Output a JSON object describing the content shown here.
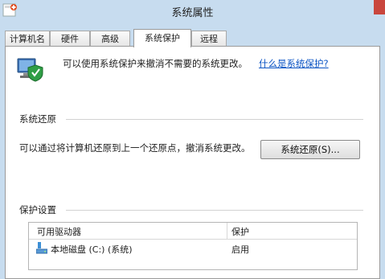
{
  "window": {
    "title": "系统属性"
  },
  "tabs": [
    {
      "label": "计算机名"
    },
    {
      "label": "硬件"
    },
    {
      "label": "高级"
    },
    {
      "label": "系统保护",
      "active": true
    },
    {
      "label": "远程"
    }
  ],
  "intro": {
    "text": "可以使用系统保护来撤消不需要的系统更改。",
    "link": "什么是系统保护?"
  },
  "restore": {
    "section_title": "系统还原",
    "description": "可以通过将计算机还原到上一个还原点，撤消系统更改。",
    "button": "系统还原(S)..."
  },
  "protection": {
    "section_title": "保护设置",
    "columns": [
      "可用驱动器",
      "保护"
    ],
    "rows": [
      {
        "drive": "本地磁盘 (C:) (系统)",
        "status": "启用"
      }
    ]
  },
  "icons": {
    "app": "system-properties-icon",
    "section": "computer-shield-icon",
    "drive": "disk-drive-icon"
  },
  "colors": {
    "titlebar": "#c7dcef",
    "link": "#0b54c4",
    "close": "#c9463d"
  }
}
